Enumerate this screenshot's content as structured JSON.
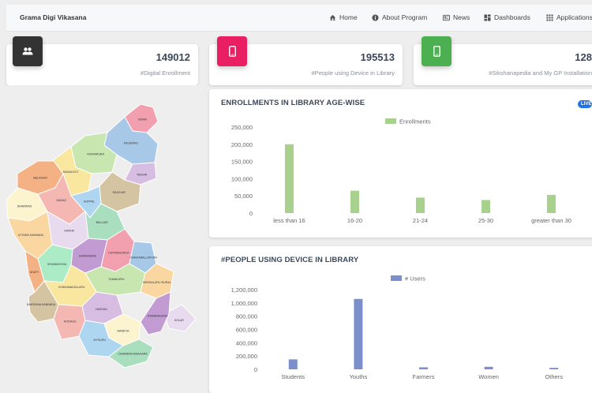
{
  "nav": {
    "brand": "Grama Digi Vikasana",
    "items": [
      {
        "label": "Home",
        "icon": "home-icon"
      },
      {
        "label": "About Program",
        "icon": "info-icon"
      },
      {
        "label": "News",
        "icon": "news-icon"
      },
      {
        "label": "Dashboards",
        "icon": "dashboard-icon"
      },
      {
        "label": "Applications",
        "icon": "apps-icon"
      }
    ]
  },
  "stats": [
    {
      "value": "149012",
      "label": "#Digital Enrollment",
      "icon": "people-icon",
      "color": "#3c3c3c"
    },
    {
      "value": "195513",
      "label": "#People using Device in Library",
      "icon": "mobile-device-icon",
      "color": "#e91e63"
    },
    {
      "value": "128",
      "label": "#Sikshanapedia and My GP Installation",
      "icon": "mobile-device-icon",
      "color": "#4caf50"
    }
  ],
  "map": {
    "labels": [
      "BIDAR",
      "KALBURGI",
      "VIJAYAPURA",
      "BELAGAVI",
      "BAGALKOT",
      "YADGIR",
      "RAICHUR",
      "DHARWAD",
      "GADAG",
      "KOPPAL",
      "BALLARI",
      "HAVERI",
      "UTTARA KANNADA",
      "DAVANGERE",
      "SHIVAMOGGA",
      "CHITRADURGA",
      "CHIKKABALLAPURA",
      "TUMAKURU",
      "UDUPI",
      "CHIKKAMAGALURU",
      "HASSAN",
      "DAKSHINA KANNADA",
      "MANDYA",
      "KODAGU",
      "MYSURU",
      "CHAMARAJANAGARA",
      "KOLAR",
      "BENGALURU RURAL",
      "RAMANAGARA"
    ],
    "colors": [
      "#f2a0b0",
      "#a8c8e8",
      "#c8e6b0",
      "#f4b183",
      "#f9e79f",
      "#d7bde2",
      "#d5c4a1",
      "#fcf3cf",
      "#f5b7b1",
      "#aed6f1",
      "#a9dfbf",
      "#e8daef",
      "#fad7a0",
      "#c39bd3",
      "#abebc6"
    ]
  },
  "chart1": {
    "title": "ENROLLMENTS IN LIBRARY AGE-WISE",
    "badge": "LIVE",
    "chart_data": {
      "type": "bar",
      "categories": [
        "less than 16",
        "16-20",
        "21-24",
        "25-30",
        "greater than 30"
      ],
      "series": [
        {
          "name": "Enrollments",
          "values": [
            200000,
            65000,
            45000,
            38000,
            53000
          ]
        }
      ],
      "yticks": [
        "250,000",
        "200,000",
        "150,000",
        "100,000",
        "50,000",
        "0"
      ],
      "ylim": [
        0,
        250000
      ],
      "color": "#a9d18e",
      "legend": "top-center"
    }
  },
  "chart2": {
    "title": "#PEOPLE USING DEVICE IN LIBRARY",
    "chart_data": {
      "type": "bar",
      "categories": [
        "Students",
        "Youths",
        "Farmers",
        "Women",
        "Others"
      ],
      "series": [
        {
          "name": "# Users",
          "values": [
            150000,
            1060000,
            30000,
            38000,
            22000
          ]
        }
      ],
      "yticks": [
        "1,200,000",
        "1,000,000",
        "800,000",
        "600,000",
        "400,000",
        "200,000",
        "0"
      ],
      "ylim": [
        0,
        1200000
      ],
      "color": "#7b8fcb",
      "legend": "top-center"
    }
  }
}
